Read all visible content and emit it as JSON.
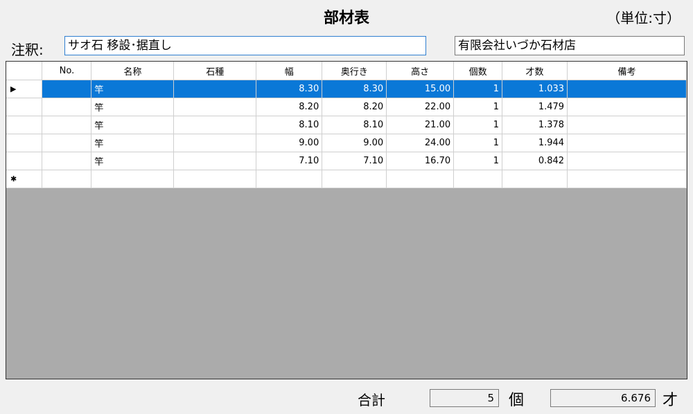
{
  "header": {
    "title": "部材表",
    "unit": "（単位:寸）"
  },
  "note": {
    "label": "注釈:",
    "value": "サオ石 移設･据直し"
  },
  "company": "有限会社いづか石材店",
  "table": {
    "columns": [
      "No.",
      "名称",
      "石種",
      "幅",
      "奥行き",
      "高さ",
      "個数",
      "才数",
      "備考"
    ],
    "rows": [
      {
        "no": "",
        "name": "竿",
        "stone": "",
        "width": "8.30",
        "depth": "8.30",
        "height": "15.00",
        "count": "1",
        "sai": "1.033",
        "note": ""
      },
      {
        "no": "",
        "name": "竿",
        "stone": "",
        "width": "8.20",
        "depth": "8.20",
        "height": "22.00",
        "count": "1",
        "sai": "1.479",
        "note": ""
      },
      {
        "no": "",
        "name": "竿",
        "stone": "",
        "width": "8.10",
        "depth": "8.10",
        "height": "21.00",
        "count": "1",
        "sai": "1.378",
        "note": ""
      },
      {
        "no": "",
        "name": "竿",
        "stone": "",
        "width": "9.00",
        "depth": "9.00",
        "height": "24.00",
        "count": "1",
        "sai": "1.944",
        "note": ""
      },
      {
        "no": "",
        "name": "竿",
        "stone": "",
        "width": "7.10",
        "depth": "7.10",
        "height": "16.70",
        "count": "1",
        "sai": "0.842",
        "note": ""
      }
    ],
    "selected_row": 0,
    "current_row_glyph": "▶",
    "new_row_glyph": "✱"
  },
  "totals": {
    "label": "合計",
    "count": "5",
    "count_unit": "個",
    "sai": "6.676",
    "sai_unit": "才"
  },
  "colors": {
    "selection": "#0a78d7",
    "background": "#f0f0f0",
    "grid_empty": "#ababab"
  }
}
